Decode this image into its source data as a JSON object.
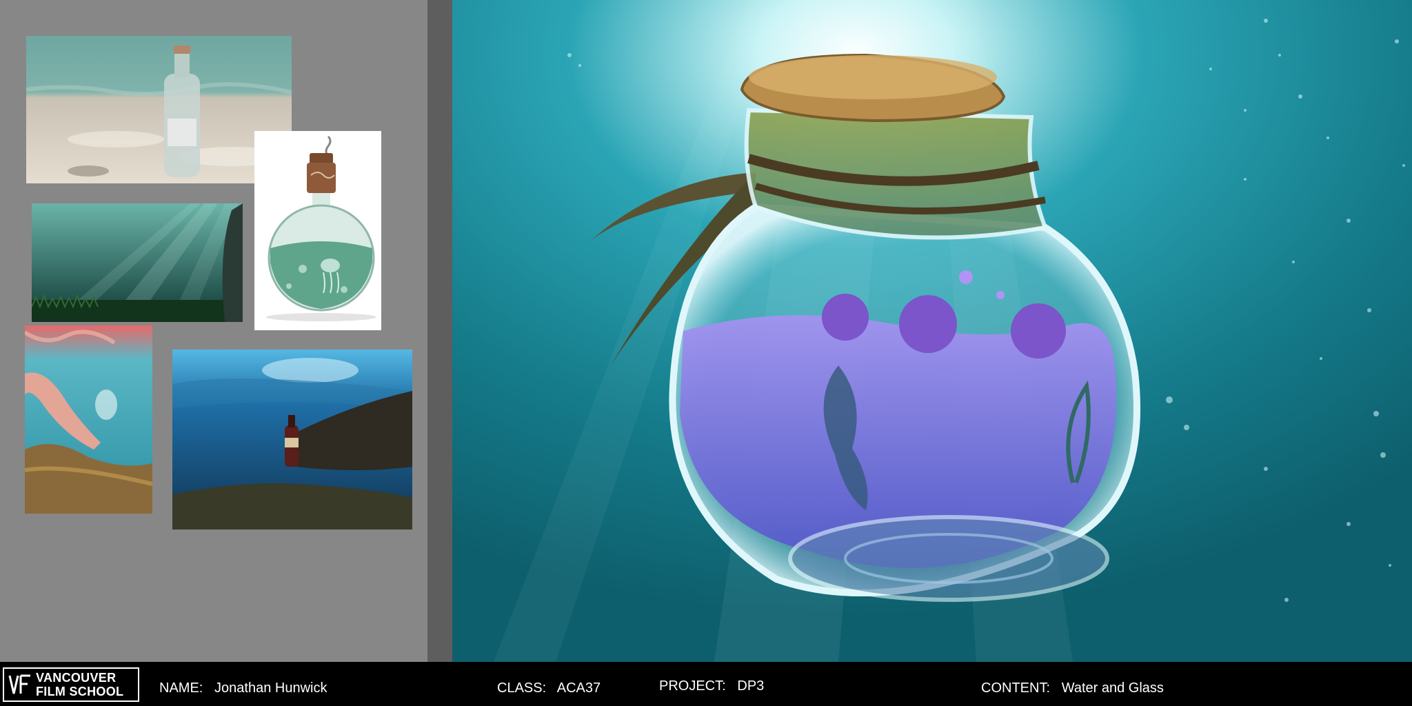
{
  "footer": {
    "logo": {
      "line1": "VANCOUVER",
      "line2": "FILM SCHOOL"
    },
    "name": {
      "label": "NAME:",
      "value": "Jonathan Hunwick"
    },
    "class": {
      "label": "CLASS:",
      "value": "ACA37"
    },
    "project": {
      "label": "PROJECT:",
      "value": "DP3"
    },
    "content": {
      "label": "CONTENT:",
      "value": "Water and Glass"
    }
  },
  "colors": {
    "panel_bg": "#878787",
    "gutter": "#5e5e5e",
    "footer_bg": "#000000",
    "water": "#1b8a98",
    "potion": "#8a7be0"
  },
  "images": [
    "reference-bottle-sand-photo",
    "reference-potion-bottle-jellyfish",
    "reference-underwater-light-rays-photo",
    "reference-hand-holding-bottle-photo",
    "reference-bottle-on-reef-photo",
    "main-concept-potion-bottle-underwater"
  ]
}
